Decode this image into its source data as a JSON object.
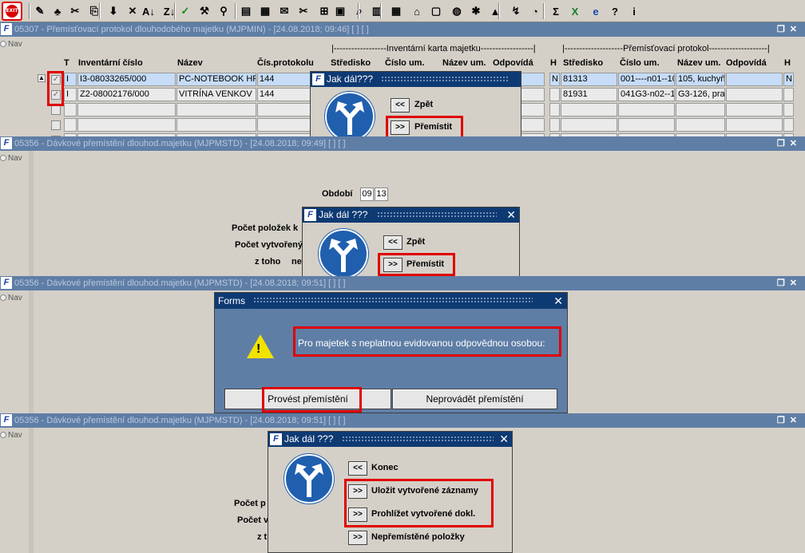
{
  "toolbar": {
    "exit_label": "EXIT",
    "icons": [
      "save-icon",
      "print-icon",
      "user-icon",
      "cut-icon",
      "copy-icon",
      "paste-icon",
      "sort-asc-icon",
      "sort-desc-icon",
      "check-icon",
      "wrench-icon",
      "filter-icon",
      "form-icon",
      "list-icon",
      "mail-icon",
      "scissors-icon",
      "tree-icon",
      "calendar-icon",
      "magnifier-icon",
      "grid-icon",
      "grid2-icon",
      "building-icon",
      "document-icon",
      "globe-icon",
      "network-icon",
      "triangle-icon",
      "chart-icon",
      "pie-icon",
      "sum-icon",
      "excel-icon",
      "ie-icon",
      "help-icon",
      "info-icon"
    ],
    "glyphs": [
      "✎",
      "♣",
      "✂",
      "⎘",
      "⬇",
      "✕",
      "A↓",
      "Z↓",
      "✓",
      "⚒",
      "⚲",
      "▤",
      "▦",
      "✉",
      "✂",
      "⊞",
      "▣",
      "⌕",
      "▥",
      "▦",
      "⌂",
      "▢",
      "◍",
      "✱",
      "▲",
      "↯",
      "◔",
      "Σ",
      "X",
      "e",
      "?",
      "i"
    ]
  },
  "panel1": {
    "title": "05307 - Přemísťovací protokol dlouhodobého majetku (MJPMIN) - [24.08.2018; 09:46]  [ ]  [ ]",
    "nav": "Nav",
    "group1": "|------------------Inventární karta majetku------------------|",
    "group2": "|--------------------Přemísťovací protokol--------------------|",
    "headers": {
      "t": "T",
      "inv": "Inventární číslo",
      "nazev": "Název",
      "cis": "Čís.protokolu",
      "str1": "Středisko",
      "cislo1": "Číslo um.",
      "nazev1": "Název um.",
      "odp1": "Odpovídá",
      "h1": "H",
      "str2": "Středisko",
      "cislo2": "Číslo um.",
      "nazev2": "Název um.",
      "odp2": "Odpovídá",
      "h2": "H"
    },
    "rows": [
      {
        "t": "I",
        "inv": "I3-08033265/000",
        "nazev": "PC-NOTEBOOK HP",
        "cis": "144",
        "h1": "N",
        "str2": "81313",
        "cislo2": "001----n01--10",
        "nazev2": "105, kuchyň",
        "h2": "N"
      },
      {
        "t": "I",
        "inv": "Z2-08002176/000",
        "nazev": "VITRÍNA VENKOV",
        "cis": "144",
        "h1": "",
        "str2": "81931",
        "cislo2": "041G3-n02--1",
        "nazev2": "G3-126, pra",
        "h2": ""
      }
    ]
  },
  "dialog1": {
    "title": "Jak dál???",
    "back_btn": "<<",
    "back_label": "Zpět",
    "move_btn": ">>",
    "move_label": "Přemístit"
  },
  "panel2": {
    "title": "05356 - Dávkové přemístění dlouhod.majetku (MJPMSTD) - [24.08.2018; 09:49]  [ ]  [ ]",
    "nav": "Nav",
    "obdobi_label": "Období",
    "obdobi_1": "09",
    "obdobi_2": "13",
    "lbl1": "Počet položek k",
    "lbl2": "Počet vytvořený",
    "lbl3": "z toho",
    "lbl3b": "ne"
  },
  "dialog2": {
    "title": "Jak dál ???",
    "back_btn": "<<",
    "back_label": "Zpět",
    "move_btn": ">>",
    "move_label": "Přemístit"
  },
  "panel3": {
    "title": "05356 - Dávkové přemístění dlouhod.majetku (MJPMSTD) - [24.08.2018; 09:51]  [ ]  [ ]",
    "nav": "Nav"
  },
  "forms_dialog": {
    "title": "Forms",
    "message": "Pro majetek s neplatnou evidovanou odpovědnou osobou:",
    "btn_yes": "Provést přemístění",
    "btn_no": "Neprovádět přemístění"
  },
  "panel4": {
    "title": "05356 - Dávkové přemístění dlouhod.majetku (MJPMSTD) - [24.08.2018; 09:51]  [ ]  [ ]",
    "nav": "Nav",
    "lbl1": "Počet p",
    "lbl2": "Počet v",
    "lbl3": "z t"
  },
  "dialog4": {
    "title": "Jak dál ???",
    "end_btn": "<<",
    "end_label": "Konec",
    "save_btn": ">>",
    "save_label": "Uložit vytvořené záznamy",
    "browse_btn": ">>",
    "browse_label": "Prohlížet vytvořené dokl.",
    "unmoved_btn": ">>",
    "unmoved_label": "Nepřemístěné položky"
  },
  "colors": {
    "highlight": "#e00000",
    "titlebar": "#5f7ea6",
    "dialog_title": "#0e3a73",
    "sign": "#1f5fae"
  }
}
